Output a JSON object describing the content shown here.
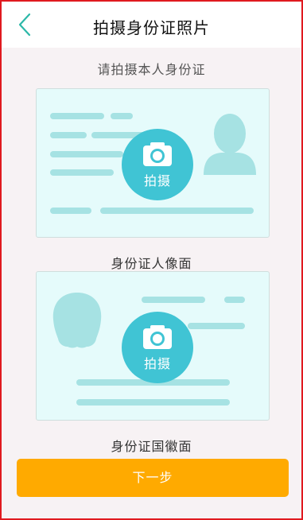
{
  "header": {
    "title": "拍摄身份证照片",
    "back_icon": "chevron-left-icon"
  },
  "instruction": "请拍摄本人身份证",
  "cards": [
    {
      "label": "身份证人像面",
      "capture_label": "拍摄",
      "icon": "camera-icon"
    },
    {
      "label": "身份证国徽面",
      "capture_label": "拍摄",
      "icon": "camera-icon"
    }
  ],
  "next_button": "下一步",
  "colors": {
    "accent": "#40c4d4",
    "primary_button": "#ffaa00",
    "card_bg": "#e5fbfb",
    "placeholder": "#a6e2e3"
  }
}
